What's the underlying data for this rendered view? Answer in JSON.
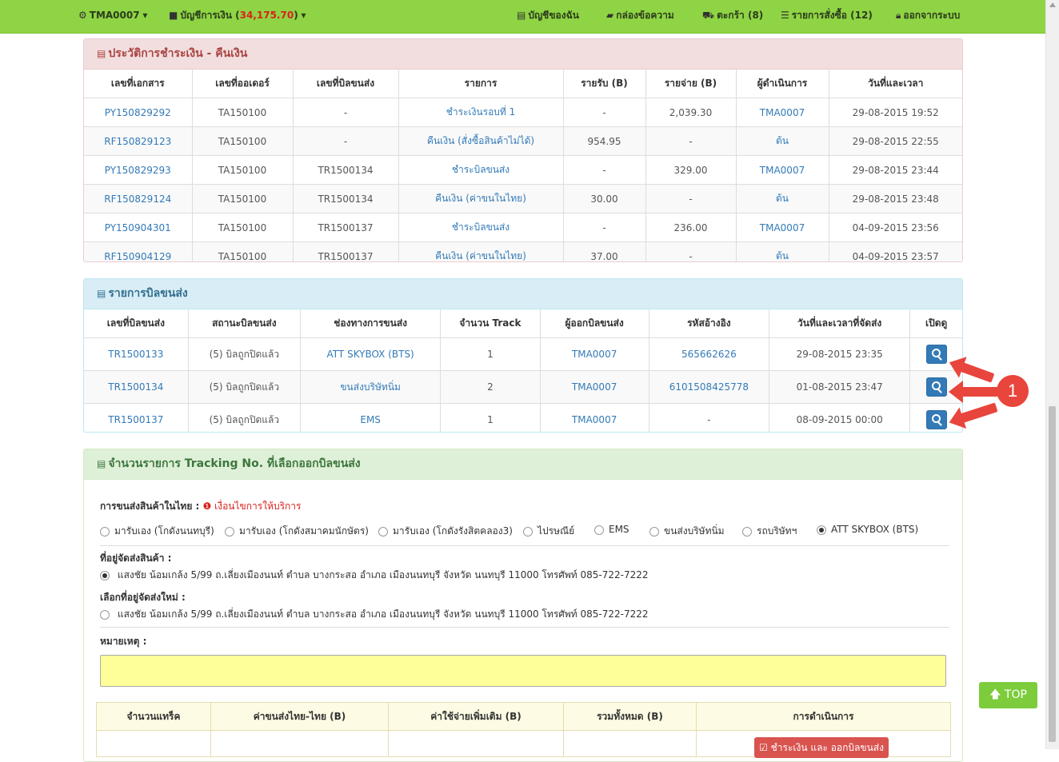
{
  "nav": {
    "user": "TMA0007",
    "account_label": "บัญชีการเงิน (",
    "account_balance": "34,175.70",
    "account_close": ")",
    "my_account": "บัญชีของฉัน",
    "messages": "กล่องข้อความ",
    "cart": "ตะกร้า (8)",
    "orders": "รายการสั่งซื้อ (12)",
    "logout": "ออกจากระบบ"
  },
  "payments": {
    "title": "ประวัติการชำระเงิน - คืนเงิน",
    "headers": [
      "เลขที่เอกสาร",
      "เลขที่ออเดอร์",
      "เลขที่บิลขนส่ง",
      "รายการ",
      "รายรับ (B)",
      "รายจ่าย (B)",
      "ผู้ดำเนินการ",
      "วันที่และเวลา"
    ],
    "rows": [
      {
        "doc": "PY150829292",
        "order": "TA150100",
        "bill": "-",
        "item": "ชำระเงินรอบที่ 1",
        "income": "-",
        "expense": "2,039.30",
        "operator": "TMA0007",
        "datetime": "29-08-2015 19:52"
      },
      {
        "doc": "RF150829123",
        "order": "TA150100",
        "bill": "-",
        "item": "คืนเงิน (สั่งซื้อสินค้าไม่ได้)",
        "income": "954.95",
        "expense": "-",
        "operator": "ต้น",
        "datetime": "29-08-2015 22:55"
      },
      {
        "doc": "PY150829293",
        "order": "TA150100",
        "bill": "TR1500134",
        "item": "ชำระบิลขนส่ง",
        "income": "-",
        "expense": "329.00",
        "operator": "TMA0007",
        "datetime": "29-08-2015 23:44"
      },
      {
        "doc": "RF150829124",
        "order": "TA150100",
        "bill": "TR1500134",
        "item": "คืนเงิน (ค่าขนในไทย)",
        "income": "30.00",
        "expense": "-",
        "operator": "ต้น",
        "datetime": "29-08-2015 23:48"
      },
      {
        "doc": "PY150904301",
        "order": "TA150100",
        "bill": "TR1500137",
        "item": "ชำระบิลขนส่ง",
        "income": "-",
        "expense": "236.00",
        "operator": "TMA0007",
        "datetime": "04-09-2015 23:56"
      },
      {
        "doc": "RF150904129",
        "order": "TA150100",
        "bill": "TR1500137",
        "item": "คืนเงิน (ค่าขนในไทย)",
        "income": "37.00",
        "expense": "-",
        "operator": "ต้น",
        "datetime": "04-09-2015 23:57"
      }
    ]
  },
  "bills": {
    "title": "รายการบิลขนส่ง",
    "headers": [
      "เลขที่บิลขนส่ง",
      "สถานะบิลขนส่ง",
      "ช่องทางการขนส่ง",
      "จำนวน Track",
      "ผู้ออกบิลขนส่ง",
      "รหัสอ้างอิง",
      "วันที่และเวลาที่จัดส่ง",
      "เปิดดู"
    ],
    "rows": [
      {
        "bill": "TR1500133",
        "status": "(5) บิลถูกปิดแล้ว",
        "channel": "ATT SKYBOX (BTS)",
        "tracks": "1",
        "issuer": "TMA0007",
        "ref": "565662626",
        "datetime": "29-08-2015 23:35"
      },
      {
        "bill": "TR1500134",
        "status": "(5) บิลถูกปิดแล้ว",
        "channel": "ขนส่งบริษัทนิ่ม",
        "tracks": "2",
        "issuer": "TMA0007",
        "ref": "6101508425778",
        "datetime": "01-08-2015 23:47"
      },
      {
        "bill": "TR1500137",
        "status": "(5) บิลถูกปิดแล้ว",
        "channel": "EMS",
        "tracks": "1",
        "issuer": "TMA0007",
        "ref": "-",
        "datetime": "08-09-2015 00:00"
      }
    ],
    "annotation": "1"
  },
  "tracking": {
    "title": "จำนวนรายการ Tracking No. ที่เลือกออกบิลขนส่ง",
    "shipping_label": "การขนส่งสินค้าในไทย :",
    "terms_link": "เงื่อนไขการให้บริการ",
    "options": [
      "มารับเอง (โกดังนนทบุรี)",
      "มารับเอง (โกดังสมาคมนักษัตร)",
      "มารับเอง (โกดังรังสิตคลอง3)",
      "ไปรษณีย์",
      "EMS",
      "ขนส่งบริษัทนิ่ม",
      "รถบริษัทฯ",
      "ATT SKYBOX (BTS)"
    ],
    "selected_option": "ATT SKYBOX (BTS)",
    "address_label": "ที่อยู่จัดส่งสินค้า :",
    "address": "แสงชัย น้อมเกล้ง    5/99 ถ.เลี่ยงเมืองนนท์   ตำบล บางกระสอ   อำเภอ เมืองนนทบุรี   จังหวัด นนทบุรี    11000    โทรศัพท์ 085-722-7222",
    "new_address_label": "เลือกที่อยู่จัดส่งใหม่ :",
    "new_address": "แสงชัย น้อมเกล้ง    5/99 ถ.เลี่ยงเมืองนนท์   ตำบล บางกระสอ   อำเภอ เมืองนนทบุรี   จังหวัด นนทบุรี    11000    โทรศัพท์ 085-722-7222",
    "remark_label": "หมายเหตุ :",
    "summary_headers": [
      "จำนวนแทร็ค",
      "ค่าขนส่งไทย-ไทย (B)",
      "ค่าใช้จ่ายเพิ่มเติม (B)",
      "รวมทั้งหมด (B)",
      "การดำเนินการ"
    ],
    "pay_button": "ชำระเงิน และ ออกบิลขนส่ง"
  },
  "top_button": "TOP",
  "colors": {
    "topbar": "#8fd444",
    "link": "#337ab7",
    "negative": "#d9231d",
    "annotation": "#e8453c"
  }
}
